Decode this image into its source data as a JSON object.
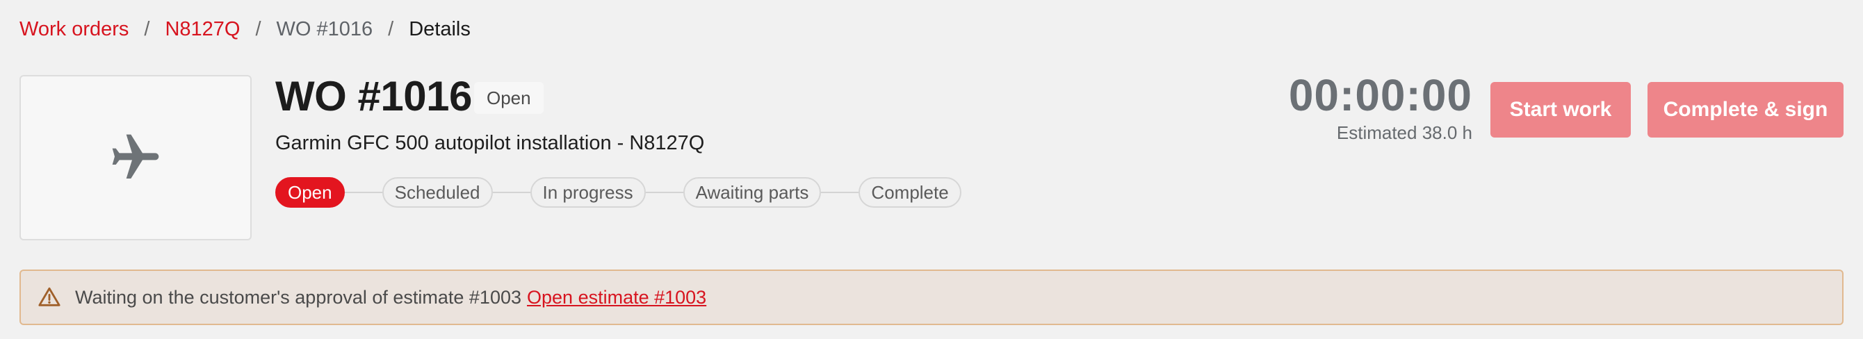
{
  "breadcrumb": {
    "items": [
      {
        "label": "Work orders"
      },
      {
        "label": "N8127Q"
      },
      {
        "label": "WO #1016"
      },
      {
        "label": "Details"
      }
    ],
    "separator": "/"
  },
  "work_order": {
    "title": "WO #1016",
    "status_badge": "Open",
    "description": "Garmin GFC 500 autopilot installation - N8127Q",
    "thumbnail_icon": "airplane-icon"
  },
  "stepper": {
    "steps": [
      {
        "label": "Open",
        "active": true
      },
      {
        "label": "Scheduled",
        "active": false
      },
      {
        "label": "In progress",
        "active": false
      },
      {
        "label": "Awaiting parts",
        "active": false
      },
      {
        "label": "Complete",
        "active": false
      }
    ]
  },
  "timer": {
    "value": "00:00:00",
    "estimate": "Estimated 38.0 h"
  },
  "actions": {
    "start_label": "Start work",
    "complete_label": "Complete & sign"
  },
  "alert": {
    "icon": "warning-icon",
    "message": "Waiting on the customer's approval of estimate #1003",
    "link_label": "Open estimate #1003"
  },
  "colors": {
    "accent": "#e3151f",
    "link": "#d7141f",
    "button_disabled": "#ee858a",
    "alert_bg": "#ebe3dd",
    "alert_border": "#e1b98f",
    "warning_icon": "#a0602a"
  }
}
